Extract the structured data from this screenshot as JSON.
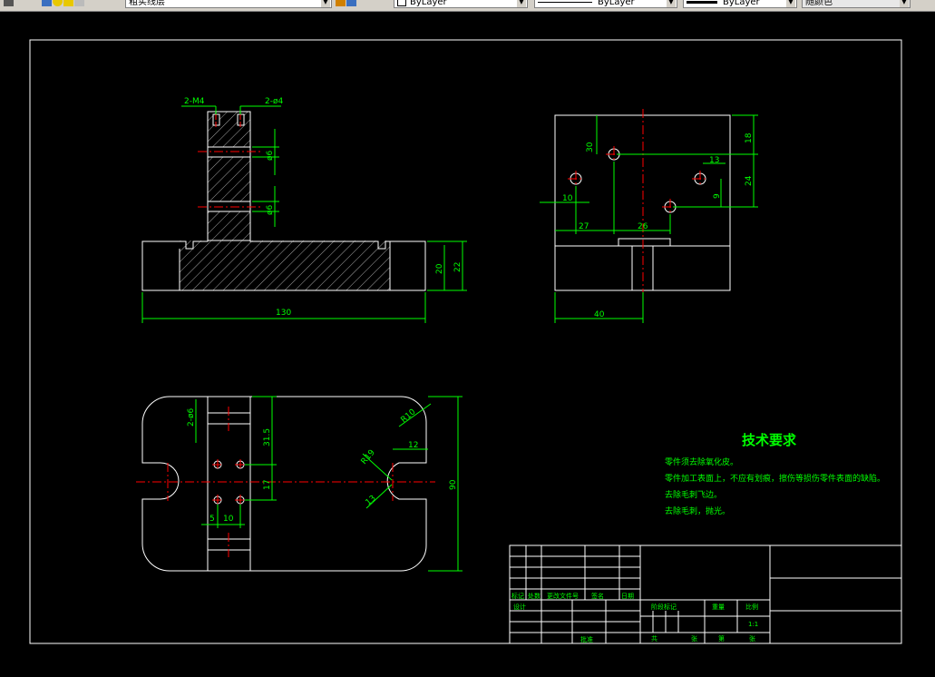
{
  "toolbar": {
    "layer_name": "粗实线层",
    "color_value": "ByLayer",
    "linetype_value": "ByLayer",
    "lineweight_value": "ByLayer",
    "plotstyle_value": "随颜色"
  },
  "colors": {
    "background": "#000000",
    "outline": "#ffffff",
    "dimension": "#00ff00",
    "centerline": "#ff0000",
    "text": "#00ff00"
  },
  "drawing": {
    "front_view_dims": {
      "thread_left": "2-M4",
      "thread_right": "2-ø4",
      "width": "130",
      "height_small": "20",
      "height_total": "22",
      "dia_a": "ø6",
      "dia_b": "ø6"
    },
    "side_view_dims": {
      "d30": "30",
      "d18": "18",
      "d13": "13",
      "d24": "24",
      "d9": "9",
      "d10": "10",
      "d27": "27",
      "d26": "26",
      "d40": "40"
    },
    "top_view_dims": {
      "r10": "R10",
      "d2_6": "2-ø6",
      "d31_5": "31.5",
      "d17": "17",
      "d5": "5",
      "d10": "10",
      "d12": "12",
      "r19": "R19",
      "d90": "90",
      "d13": "13"
    },
    "tech_requirements": {
      "title": "技术要求",
      "lines": [
        "零件须去除氧化皮。",
        "零件加工表面上，不应有划痕，擦伤等损伤零件表面的缺陷。",
        "去除毛刺飞边。",
        "去除毛刺，抛光。"
      ]
    },
    "title_block": {
      "row_labels": [
        "标记",
        "处数",
        "更改文件号",
        "签名",
        "日期"
      ],
      "design_label": "设计",
      "process_label": "工艺",
      "approve_label": "批准",
      "stage_label": "阶段标记",
      "weight_label": "重量",
      "scale_label": "比例",
      "scale_value": "1:1",
      "total_label": "共",
      "sheets_label": "张",
      "page_label": "第",
      "sheet_label": "张"
    }
  }
}
